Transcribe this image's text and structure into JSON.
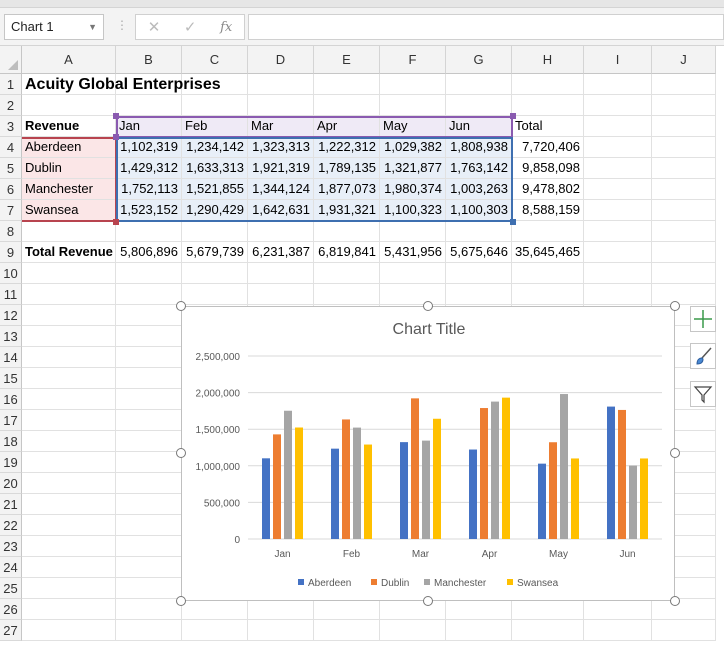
{
  "formula_bar": {
    "name_box": "Chart 1",
    "formula": ""
  },
  "sheet": {
    "columns": [
      "A",
      "B",
      "C",
      "D",
      "E",
      "F",
      "G",
      "H",
      "I",
      "J"
    ],
    "row_numbers": [
      "1",
      "2",
      "3",
      "4",
      "5",
      "6",
      "7",
      "8",
      "9",
      "10",
      "11",
      "12",
      "13",
      "14",
      "15",
      "16",
      "17",
      "18",
      "19",
      "20",
      "21",
      "22",
      "23",
      "24",
      "25",
      "26",
      "27"
    ],
    "title": "Acuity Global Enterprises",
    "header": [
      "Revenue",
      "Jan",
      "Feb",
      "Mar",
      "Apr",
      "May",
      "Jun",
      "Total"
    ],
    "rows": [
      [
        "Aberdeen",
        "1,102,319",
        "1,234,142",
        "1,323,313",
        "1,222,312",
        "1,029,382",
        "1,808,938",
        "7,720,406"
      ],
      [
        "Dublin",
        "1,429,312",
        "1,633,313",
        "1,921,319",
        "1,789,135",
        "1,321,877",
        "1,763,142",
        "9,858,098"
      ],
      [
        "Manchester",
        "1,752,113",
        "1,521,855",
        "1,344,124",
        "1,877,073",
        "1,980,374",
        "1,003,263",
        "9,478,802"
      ],
      [
        "Swansea",
        "1,523,152",
        "1,290,429",
        "1,642,631",
        "1,931,321",
        "1,100,323",
        "1,100,303",
        "8,588,159"
      ]
    ],
    "total_row": [
      "Total Revenue",
      "5,806,896",
      "5,679,739",
      "6,231,387",
      "6,819,841",
      "5,431,956",
      "5,675,646",
      "35,645,465"
    ]
  },
  "chart_data": {
    "type": "bar",
    "title": "Chart Title",
    "categories": [
      "Jan",
      "Feb",
      "Mar",
      "Apr",
      "May",
      "Jun"
    ],
    "series": [
      {
        "name": "Aberdeen",
        "color": "#4472c4",
        "values": [
          1102319,
          1234142,
          1323313,
          1222312,
          1029382,
          1808938
        ]
      },
      {
        "name": "Dublin",
        "color": "#ed7d31",
        "values": [
          1429312,
          1633313,
          1921319,
          1789135,
          1321877,
          1763142
        ]
      },
      {
        "name": "Manchester",
        "color": "#a5a5a5",
        "values": [
          1752113,
          1521855,
          1344124,
          1877073,
          1980374,
          1003263
        ]
      },
      {
        "name": "Swansea",
        "color": "#ffc000",
        "values": [
          1523152,
          1290429,
          1642631,
          1931321,
          1100323,
          1100303
        ]
      }
    ],
    "yticks": [
      "0",
      "500,000",
      "1,000,000",
      "1,500,000",
      "2,000,000",
      "2,500,000"
    ],
    "ylim": [
      0,
      2500000
    ],
    "grid": true,
    "legend": "bottom",
    "xlabel": "",
    "ylabel": ""
  },
  "chart_tools": [
    "Chart Elements",
    "Chart Styles",
    "Chart Filters"
  ]
}
